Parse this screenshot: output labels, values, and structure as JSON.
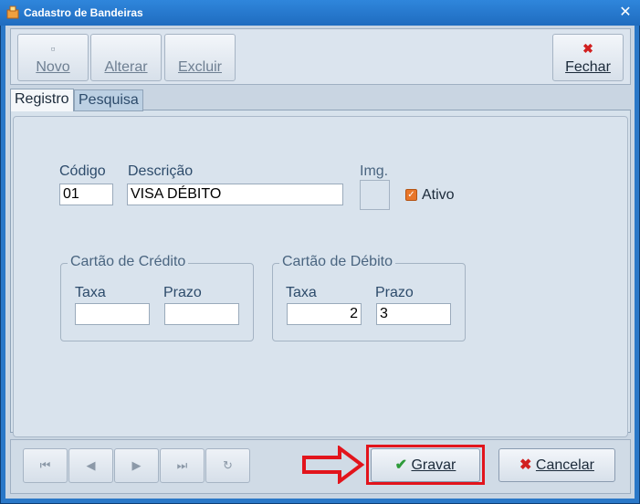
{
  "window": {
    "title": "Cadastro de Bandeiras",
    "close_glyph": "✕"
  },
  "toolbar": {
    "novo_label": "Novo",
    "alterar_label": "Alterar",
    "excluir_label": "Excluir",
    "fechar_label": "Fechar",
    "fechar_icon": "✖"
  },
  "tabs": [
    {
      "label": "Registro",
      "active": true
    },
    {
      "label": "Pesquisa",
      "active": false
    }
  ],
  "form": {
    "codigo_label": "Código",
    "codigo_value": "01",
    "descricao_label": "Descrição",
    "descricao_value": "VISA DÉBITO",
    "img_label": "Img.",
    "ativo_label": "Ativo",
    "ativo_checked": true,
    "credito": {
      "title": "Cartão de Crédito",
      "taxa_label": "Taxa",
      "taxa_value": "",
      "prazo_label": "Prazo",
      "prazo_value": ""
    },
    "debito": {
      "title": "Cartão de Débito",
      "taxa_label": "Taxa",
      "taxa_value": "2",
      "prazo_label": "Prazo",
      "prazo_value": "3"
    }
  },
  "navigation": {
    "first_icon": "⏮",
    "prev_icon": "◀",
    "next_icon": "▶",
    "last_icon": "⏭",
    "refresh_icon": "↻"
  },
  "actions": {
    "gravar_label": "Gravar",
    "gravar_icon": "✔",
    "cancelar_label": "Cancelar",
    "cancelar_icon": "✖"
  },
  "colors": {
    "accent_red": "#e2141c",
    "check_green": "#2e9b3a",
    "title_blue": "#2f86dc"
  }
}
